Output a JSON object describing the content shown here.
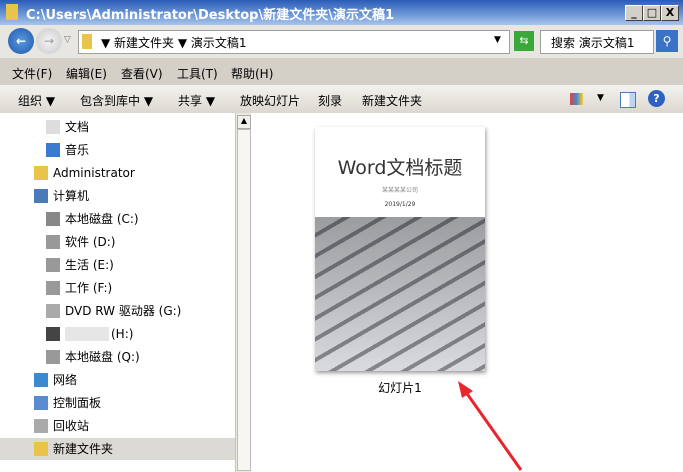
{
  "window": {
    "title": "C:\\Users\\Administrator\\Desktop\\新建文件夹\\演示文稿1",
    "min": "_",
    "max": "□",
    "close": "X"
  },
  "address": {
    "crumbs": [
      "新建文件夹",
      "演示文稿1"
    ],
    "search_placeholder": "搜索 演示文稿1"
  },
  "menu": [
    "文件(F)",
    "编辑(E)",
    "查看(V)",
    "工具(T)",
    "帮助(H)"
  ],
  "toolbar": [
    "组织 ▼",
    "包含到库中 ▼",
    "共享 ▼",
    "放映幻灯片",
    "刻录",
    "新建文件夹"
  ],
  "sidebar": [
    {
      "label": "文档",
      "indent": 1
    },
    {
      "label": "音乐",
      "indent": 1
    },
    {
      "label": "Administrator",
      "indent": 0
    },
    {
      "label": "计算机",
      "indent": 0
    },
    {
      "label": "本地磁盘 (C:)",
      "indent": 1
    },
    {
      "label": "软件 (D:)",
      "indent": 1
    },
    {
      "label": "生活 (E:)",
      "indent": 1
    },
    {
      "label": "工作 (F:)",
      "indent": 1
    },
    {
      "label": "DVD RW 驱动器 (G:)",
      "indent": 1
    },
    {
      "label": "(H:)",
      "indent": 1
    },
    {
      "label": "本地磁盘 (Q:)",
      "indent": 1
    },
    {
      "label": "网络",
      "indent": 0
    },
    {
      "label": "控制面板",
      "indent": 0
    },
    {
      "label": "回收站",
      "indent": 0
    },
    {
      "label": "新建文件夹",
      "indent": 0,
      "selected": true
    }
  ],
  "file": {
    "name": "幻灯片1",
    "slide_title": "Word文档标题",
    "slide_company": "某某某某公司",
    "slide_date": "2019/1/29"
  },
  "colors": {
    "arrow": "#e8242c",
    "title_bar": "#2b5bb8"
  }
}
